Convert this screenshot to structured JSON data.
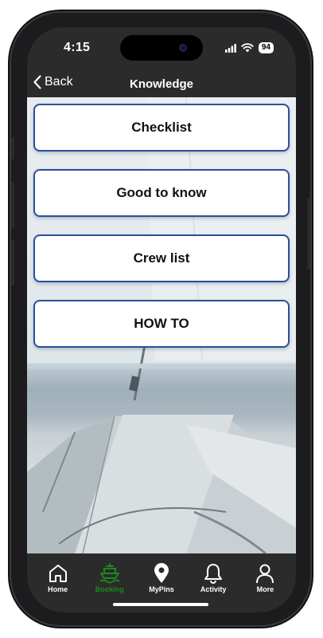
{
  "status_bar": {
    "time": "4:15",
    "battery": "94"
  },
  "nav": {
    "back_label": "Back",
    "title": "Knowledge"
  },
  "menu": {
    "items": [
      {
        "label": "Checklist"
      },
      {
        "label": "Good to know"
      },
      {
        "label": "Crew list"
      },
      {
        "label": "HOW TO"
      }
    ]
  },
  "tab_bar": {
    "tabs": [
      {
        "label": "Home",
        "icon": "home-icon"
      },
      {
        "label": "Booking",
        "icon": "boat-icon",
        "active": true
      },
      {
        "label": "MyPins",
        "icon": "map-pin-icon"
      },
      {
        "label": "Activity",
        "icon": "bell-icon"
      },
      {
        "label": "More",
        "icon": "person-icon"
      }
    ],
    "active_color": "#1b8a1b"
  },
  "colors": {
    "bar_background": "#2b2b2b",
    "button_border": "#2a4f9c"
  }
}
